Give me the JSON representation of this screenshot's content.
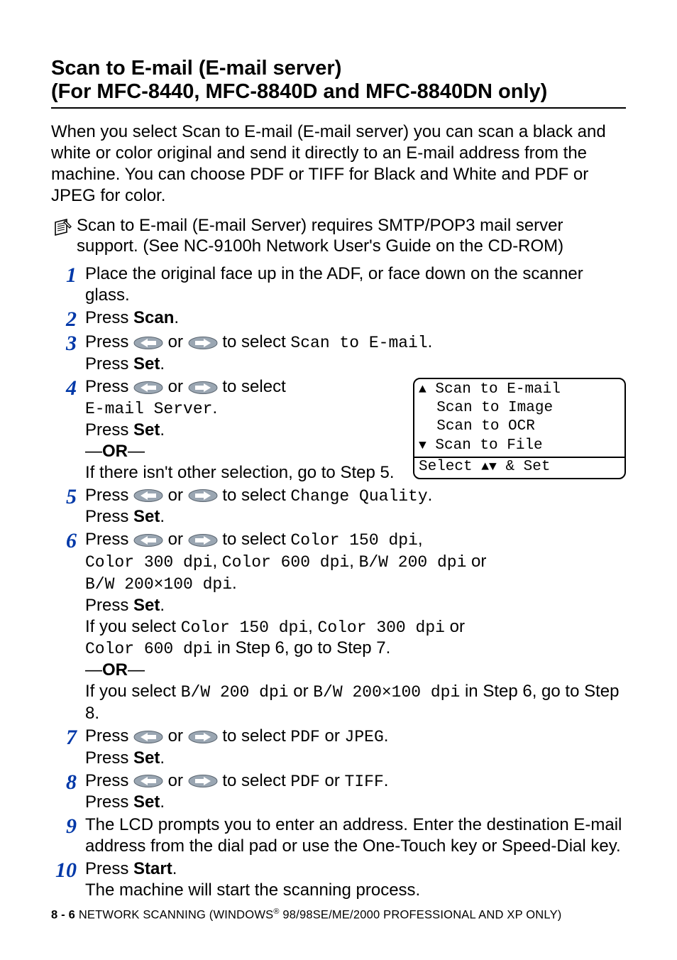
{
  "heading_line1": "Scan to E-mail (E-mail server)",
  "heading_line2": "(For MFC-8440, MFC-8840D and MFC-8840DN only)",
  "intro": "When you select Scan to E-mail (E-mail server) you can scan a black and white or color original and send it directly to an E-mail address from the machine. You can choose PDF or TIFF for Black and White and PDF or JPEG for color.",
  "note": "Scan to E-mail (E-mail Server) requires SMTP/POP3 mail server support. (See NC-9100h Network User's Guide on the CD-ROM)",
  "steps": {
    "n1": "1",
    "s1": "Place the original face up in the ADF, or face down on the scanner glass.",
    "n2": "2",
    "s2a": "Press ",
    "s2b": "Scan",
    "s2c": ".",
    "n3": "3",
    "s3a": "Press ",
    "s3b": " or ",
    "s3c": " to select ",
    "s3d": "Scan to E-mail",
    "s3e": ".",
    "s3f": "Press ",
    "s3g": "Set",
    "s3h": ".",
    "n4": "4",
    "s4a": "Press ",
    "s4b": " or ",
    "s4c": " to select",
    "s4d": "E-mail Server",
    "s4e": ".",
    "s4f": "Press ",
    "s4g": "Set",
    "s4h": ".",
    "s4i": "—",
    "s4j": "OR",
    "s4k": "—",
    "s4l": "If there isn't other selection, go to Step 5.",
    "n5": "5",
    "s5a": "Press ",
    "s5b": " or ",
    "s5c": " to select ",
    "s5d": "Change Quality",
    "s5e": ".",
    "s5f": "Press ",
    "s5g": "Set",
    "s5h": ".",
    "n6": "6",
    "s6a": "Press ",
    "s6b": " or ",
    "s6c": " to select ",
    "s6d": "Color 150 dpi",
    "s6e": ",",
    "s6f": "Color 300 dpi",
    "s6g": ", ",
    "s6h": "Color 600 dpi",
    "s6i": ", ",
    "s6j": "B/W 200 dpi",
    "s6k": " or",
    "s6l": "B/W 200×100 dpi",
    "s6m": ".",
    "s6n": "Press ",
    "s6o": "Set",
    "s6p": ".",
    "s6q": "If you select ",
    "s6r": "Color 150 dpi",
    "s6s": ", ",
    "s6t": "Color 300 dpi",
    "s6u": " or",
    "s6v": "Color 600 dpi",
    "s6w": " in Step 6, go to Step 7.",
    "s6x": "—",
    "s6y": "OR",
    "s6z": "—",
    "s6aa": "If you select ",
    "s6ab": "B/W 200 dpi",
    "s6ac": " or ",
    "s6ad": "B/W 200×100 dpi",
    "s6ae": " in Step 6, go to Step 8.",
    "n7": "7",
    "s7a": "Press ",
    "s7b": " or ",
    "s7c": " to select ",
    "s7d": "PDF",
    "s7e": " or ",
    "s7f": "JPEG",
    "s7g": ".",
    "s7h": "Press ",
    "s7i": "Set",
    "s7j": ".",
    "n8": "8",
    "s8a": "Press ",
    "s8b": " or ",
    "s8c": " to select ",
    "s8d": "PDF",
    "s8e": " or ",
    "s8f": "TIFF",
    "s8g": ".",
    "s8h": "Press ",
    "s8i": "Set",
    "s8j": ".",
    "n9": "9",
    "s9": "The LCD prompts you to enter an address. Enter the destination E-mail address from the dial pad or use the One-Touch key or Speed-Dial key.",
    "n10": "10",
    "s10a": "Press ",
    "s10b": "Start",
    "s10c": ".",
    "s10d": "The machine will start the scanning process."
  },
  "lcd": {
    "r1": "Scan to E-mail",
    "r2": "Scan to Image",
    "r3": "Scan to OCR",
    "r4": "Scan to File",
    "status_a": "Select ",
    "status_b": " & Set"
  },
  "footer": {
    "page": "8 - 6",
    "sec_a": "   NETWORK SCANNING (WINDOWS",
    "reg": "®",
    "sec_b": " 98/98SE/ME/2000 PROFESSIONAL AND XP ONLY)"
  }
}
